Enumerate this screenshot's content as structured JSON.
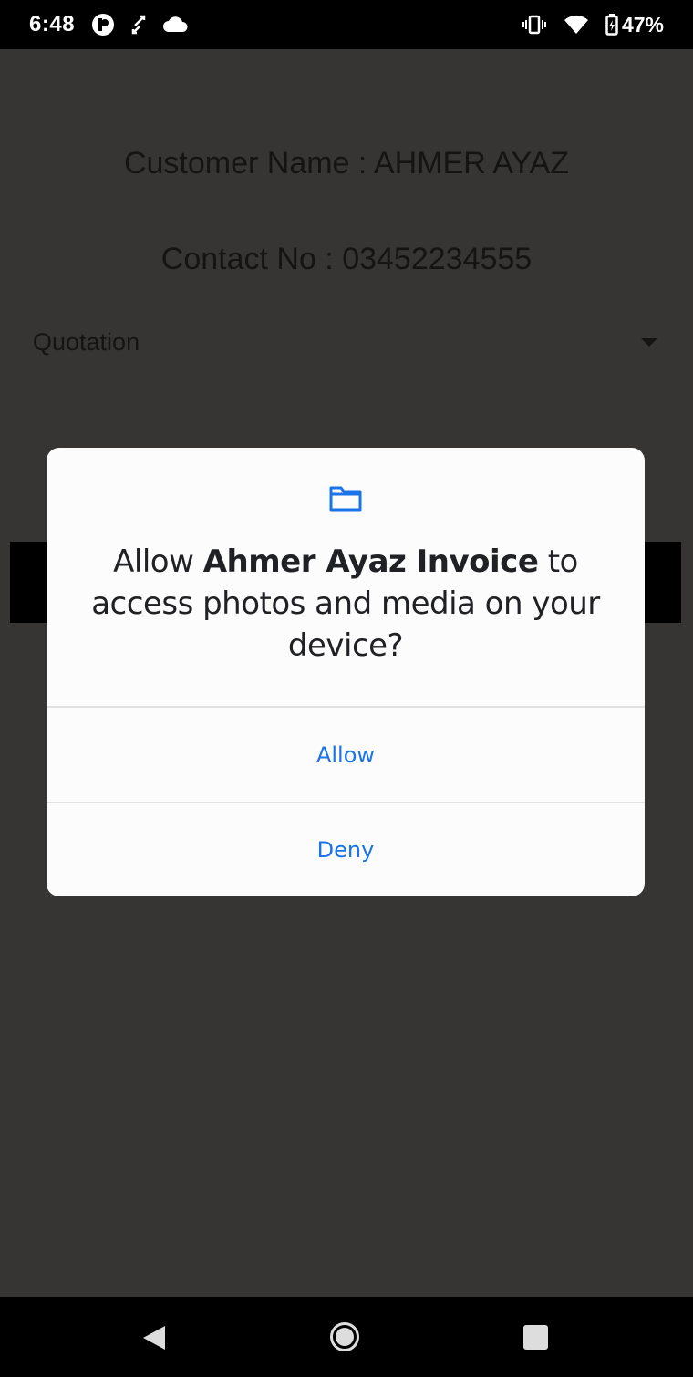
{
  "status_bar": {
    "time": "6:48",
    "battery": "47%",
    "icons": [
      "pocket-casts-icon",
      "swap-icon",
      "cloud-icon",
      "vibrate-icon",
      "wifi-icon",
      "battery-charging-icon"
    ]
  },
  "app": {
    "customer_name": "Customer Name : AHMER AYAZ",
    "contact_no": "Contact No : 03452234555",
    "document_type": "Quotation"
  },
  "dialog": {
    "icon": "folder-icon",
    "message_prefix": "Allow ",
    "app_name": "Ahmer Ayaz Invoice",
    "message_suffix": " to access photos and media on your device?",
    "allow_label": "Allow",
    "deny_label": "Deny",
    "button_color": "#1a73e8"
  },
  "nav_bar": {
    "icons": [
      "back-icon",
      "home-icon",
      "recents-icon"
    ]
  }
}
